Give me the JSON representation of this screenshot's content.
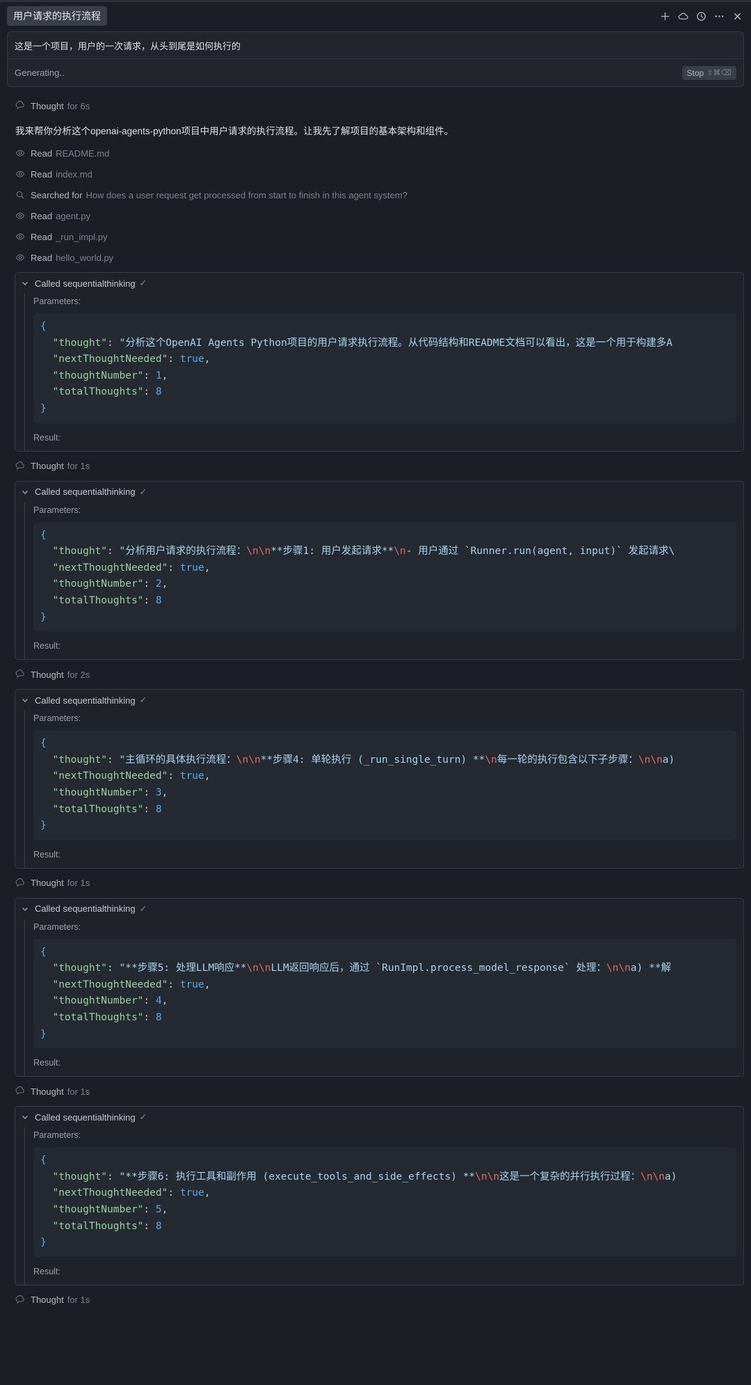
{
  "header": {
    "title": "用户请求的执行流程"
  },
  "input": {
    "text": "这是一个项目，用户的一次请求，从头到尾是如何执行的",
    "status": "Generating..",
    "stop_label": "Stop",
    "stop_kbd": "⇧⌘⌫"
  },
  "feed": {
    "thought0": {
      "verb": "Thought",
      "obj": "for 6s"
    },
    "message": "我来帮你分析这个openai-agents-python项目中用户请求的执行流程。让我先了解项目的基本架构和组件。",
    "steps": [
      {
        "verb": "Read",
        "obj": "README.md",
        "icon": "eye-icon"
      },
      {
        "verb": "Read",
        "obj": "index.md",
        "icon": "eye-icon"
      },
      {
        "verb": "Searched for",
        "obj": "How does a user request get processed from start to finish in this agent system?",
        "icon": "search-icon"
      },
      {
        "verb": "Read",
        "obj": "agent.py",
        "icon": "eye-icon"
      },
      {
        "verb": "Read",
        "obj": "_run_impl.py",
        "icon": "eye-icon"
      },
      {
        "verb": "Read",
        "obj": "hello_world.py",
        "icon": "eye-icon"
      }
    ],
    "tool_label": "Called sequentialthinking",
    "params_label": "Parameters:",
    "result_label": "Result:",
    "thoughts": [
      {
        "verb": "Thought",
        "obj": "for 1s"
      },
      {
        "verb": "Thought",
        "obj": "for 2s"
      },
      {
        "verb": "Thought",
        "obj": "for 1s"
      },
      {
        "verb": "Thought",
        "obj": "for 1s"
      },
      {
        "verb": "Thought",
        "obj": "for 1s"
      }
    ],
    "calls": [
      {
        "thought": "\"分析这个OpenAI Agents Python项目的用户请求执行流程。从代码结构和README文档可以看出，这是一个用于构建多A",
        "number": "1"
      },
      {
        "thought": "\"分析用户请求的执行流程：\\n\\n**步骤1: 用户发起请求**\\n- 用户通过 `Runner.run(agent, input)` 发起请求\\",
        "number": "2"
      },
      {
        "thought": "\"主循环的具体执行流程：\\n\\n**步骤4: 单轮执行 (_run_single_turn) **\\n每一轮的执行包含以下子步骤：\\n\\na)",
        "number": "3"
      },
      {
        "thought": "\"**步骤5: 处理LLM响应**\\n\\nLLM返回响应后，通过 `RunImpl.process_model_response` 处理：\\n\\na) **解",
        "number": "4"
      },
      {
        "thought": "\"**步骤6: 执行工具和副作用 (execute_tools_and_side_effects) **\\n\\n这是一个复杂的并行执行过程：\\n\\na)",
        "number": "5"
      }
    ],
    "next_needed": "true",
    "total": "8"
  }
}
